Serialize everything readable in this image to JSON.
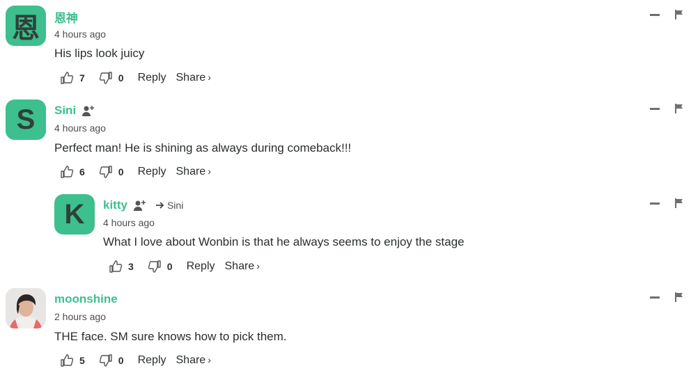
{
  "comments": [
    {
      "author": "恩神",
      "avatar_letter": "恩",
      "time": "4 hours ago",
      "text": "His lips look juicy",
      "upvotes": "7",
      "downvotes": "0",
      "reply_label": "Reply",
      "share_label": "Share",
      "share_arrow": "›"
    },
    {
      "author": "Sini",
      "avatar_letter": "S",
      "time": "4 hours ago",
      "text": "Perfect man! He is shining as always during comeback!!!",
      "upvotes": "6",
      "downvotes": "0",
      "reply_label": "Reply",
      "share_label": "Share",
      "share_arrow": "›"
    },
    {
      "author": "kitty",
      "avatar_letter": "K",
      "reply_to": "Sini",
      "time": "4 hours ago",
      "text": "What I love about Wonbin is that he always seems to enjoy the stage",
      "upvotes": "3",
      "downvotes": "0",
      "reply_label": "Reply",
      "share_label": "Share",
      "share_arrow": "›"
    },
    {
      "author": "moonshine",
      "time": "2 hours ago",
      "text": "THE face. SM sure knows how to pick them.",
      "upvotes": "5",
      "downvotes": "0",
      "reply_label": "Reply",
      "share_label": "Share",
      "share_arrow": "›"
    }
  ],
  "colors": {
    "accent": "#3dbf8e",
    "text": "#2a2e2e",
    "muted": "#4a4f4f"
  },
  "icons": [
    "thumbs-up-icon",
    "thumbs-down-icon",
    "follow-user-icon",
    "reply-arrow-icon",
    "collapse-icon",
    "flag-icon"
  ]
}
